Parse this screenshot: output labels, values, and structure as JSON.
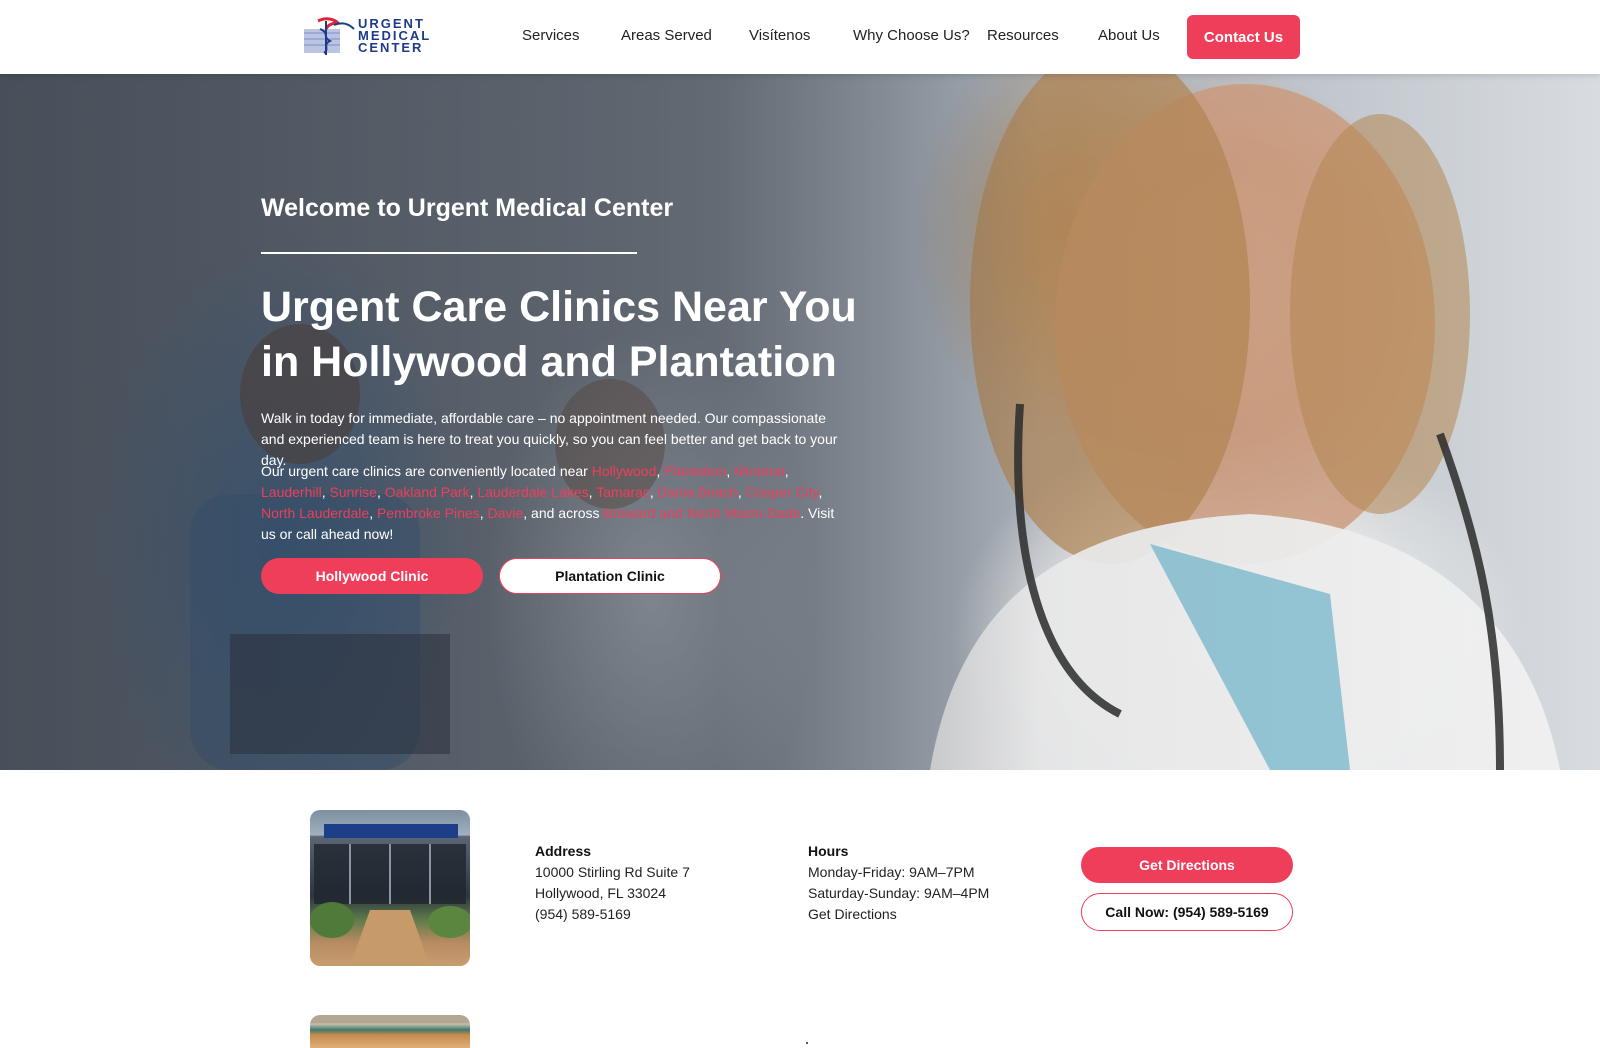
{
  "header": {
    "logo": {
      "line1": "URGENT",
      "line2": "MEDICAL",
      "line3": "CENTER"
    },
    "nav": [
      "Services",
      "Areas Served",
      "Visítenos",
      "Why Choose Us?",
      "Resources",
      "About Us"
    ],
    "contact_label": "Contact Us"
  },
  "hero": {
    "welcome": "Welcome to Urgent Medical Center",
    "headline": "Urgent Care Clinics Near You in Hollywood and Plantation",
    "intro": "Walk in today for immediate, affordable care – no appointment needed. Our compassionate and experienced team is here to treat you quickly, so you can feel better and get back to your day.",
    "locations_prefix": "Our urgent care clinics are conveniently located near ",
    "locations": [
      "Hollywood",
      "Plantation",
      "Miramar",
      "Lauderhill",
      "Sunrise",
      "Oakland Park",
      "Lauderdale Lakes",
      "Tamarac",
      "Dania Beach",
      "Cooper City",
      "North Lauderdale",
      "Pembroke Pines",
      "Davie"
    ],
    "locations_across": ", and across ",
    "region": "Broward and North Miami-Dade",
    "locations_suffix": ". Visit us or call ahead now!",
    "hollywood_button": "Hollywood Clinic",
    "plantation_button": "Plantation Clinic"
  },
  "clinic": {
    "address_label": "Address",
    "address_line1": "10000 Stirling Rd Suite 7",
    "address_line2": "Hollywood, FL 33024",
    "phone": "(954) 589-5169",
    "hours_label": "Hours",
    "hours_weekday": "Monday-Friday: 9AM–7PM",
    "hours_weekend": "Saturday-Sunday: 9AM–4PM",
    "hours_directions": "Get Directions",
    "directions_button": "Get Directions",
    "call_button": "Call Now: (954) 589-5169"
  },
  "colors": {
    "accent": "#ef3e5a",
    "brand_blue": "#1e3a8a"
  }
}
